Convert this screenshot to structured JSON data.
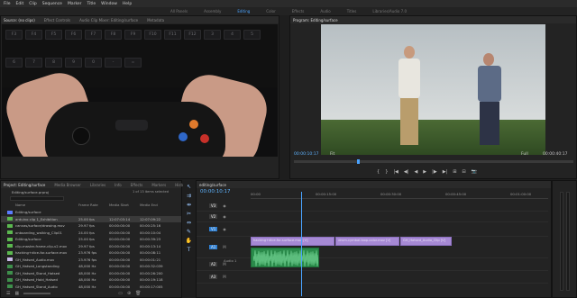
{
  "menu": [
    "File",
    "Edit",
    "Clip",
    "Sequence",
    "Marker",
    "Title",
    "Window",
    "Help"
  ],
  "workspaces": [
    "All Panels",
    "Assembly",
    "Editing",
    "Color",
    "Effects",
    "Audio",
    "Titles",
    "Libraries/Audio 7.0"
  ],
  "workspace_active": 2,
  "source_tabs": [
    "Source: (no clips)",
    "Effect Controls",
    "Audio Clip Mixer: Editing/surface",
    "Metadata"
  ],
  "program_tab": "Program: Editing/surface",
  "keyboard_keys": [
    "F3",
    "F4",
    "F5",
    "F6",
    "F7",
    "F8",
    "F9",
    "F10",
    "F11",
    "F12",
    "3",
    "4",
    "5",
    "6",
    "7",
    "8",
    "9",
    "0",
    "-",
    "="
  ],
  "program": {
    "timecode_in": "00:00:10:17",
    "fit_label": "Fit",
    "zoom": "Full",
    "timecode_out": "00:00:40:17",
    "controls": [
      "{",
      "}",
      "|◀",
      "◀|",
      "◀",
      "▶",
      "|▶",
      "▶|",
      "⊞",
      "⊟",
      "📷"
    ]
  },
  "project": {
    "tabs": [
      "Project: Editing/surface",
      "Media Browser",
      "Libraries",
      "Info",
      "Effects",
      "Markers",
      "History"
    ],
    "bin": "Editing/surface.prproj",
    "count": "1 of 13 items selected",
    "columns": [
      "Name",
      "Frame Rate",
      "Media Start",
      "Media End"
    ],
    "rows": [
      {
        "swatch": "#5b7cff",
        "name": "Editing/surface",
        "fr": "",
        "ms": "",
        "me": ""
      },
      {
        "swatch": "#5bb84f",
        "name": "arduino clip 1_Exhibition",
        "fr": "25.00 fps",
        "ms": "12:07:03:14",
        "me": "12:07:09:22"
      },
      {
        "swatch": "#5bb84f",
        "name": "canvas/surface/drawing.mov",
        "fr": "29.97 fps",
        "ms": "00:00:00:00",
        "me": "00:00:25:16"
      },
      {
        "swatch": "#5bb84f",
        "name": "onboarding_walking_Clip01",
        "fr": "24.00 fps",
        "ms": "00:00:00:00",
        "me": "00:00:10:04"
      },
      {
        "swatch": "#5bb84f",
        "name": "Editing/surface",
        "fr": "25.00 fps",
        "ms": "00:00:00:00",
        "me": "00:00:39:23"
      },
      {
        "swatch": "#5bb84f",
        "name": "clip-master-frame-clip-v2.mov",
        "fr": "29.97 fps",
        "ms": "00:00:00:00",
        "me": "00:00:13:14"
      },
      {
        "swatch": "#5bb84f",
        "name": "hacking+dice-for-surface.mov",
        "fr": "23.976 fps",
        "ms": "00:00:00:00",
        "me": "00:00:08:11"
      },
      {
        "swatch": "#c8b8e8",
        "name": "GH_Hatsed_Audio.mov",
        "fr": "23.976 fps",
        "ms": "00:00:00:00",
        "me": "00:00:01:21"
      },
      {
        "swatch": "#3e8f4b",
        "name": "GH_Hatsed_Longstanding",
        "fr": "48,000 Hz",
        "ms": "00:00:00:00",
        "me": "00:00:32:039"
      },
      {
        "swatch": "#3e8f4b",
        "name": "GH_Hatsed_Stand_Hatsed",
        "fr": "48,000 Hz",
        "ms": "00:00:00:00",
        "me": "00:00:26:200"
      },
      {
        "swatch": "#3e8f4b",
        "name": "GH_Hatsed_Hold_Hatsed",
        "fr": "48,000 Hz",
        "ms": "00:00:00:00",
        "me": "00:00:19:118"
      },
      {
        "swatch": "#3e8f4b",
        "name": "GH_Hatsed_Stand_Audio",
        "fr": "48,000 Hz",
        "ms": "00:00:00:00",
        "me": "00:00:17:005"
      }
    ]
  },
  "timeline": {
    "tab": "editing/surface",
    "timecode": "00:00:10:17",
    "ruler": [
      "00:00",
      "00:00:15:00",
      "00:00:30:00",
      "00:00:45:00",
      "00:01:00:00",
      "00:01:15:00"
    ],
    "video_tracks": [
      "V3",
      "V2",
      "V1"
    ],
    "audio_tracks": [
      "A1",
      "A2",
      "A3"
    ],
    "audio_label": "Audio 1",
    "clips": [
      {
        "label": "hacking+dice-for-surface.mov [V]",
        "start": 0.0,
        "end": 0.42
      },
      {
        "label": "drum-cymbal-loop-color.mov [V]",
        "start": 0.42,
        "end": 0.74
      },
      {
        "label": "GH_Hatsed_Audio_Clip [V]",
        "start": 0.74,
        "end": 1.0
      }
    ],
    "audio_clip": {
      "start": 0.0,
      "end": 0.23
    },
    "playhead": 0.17
  }
}
